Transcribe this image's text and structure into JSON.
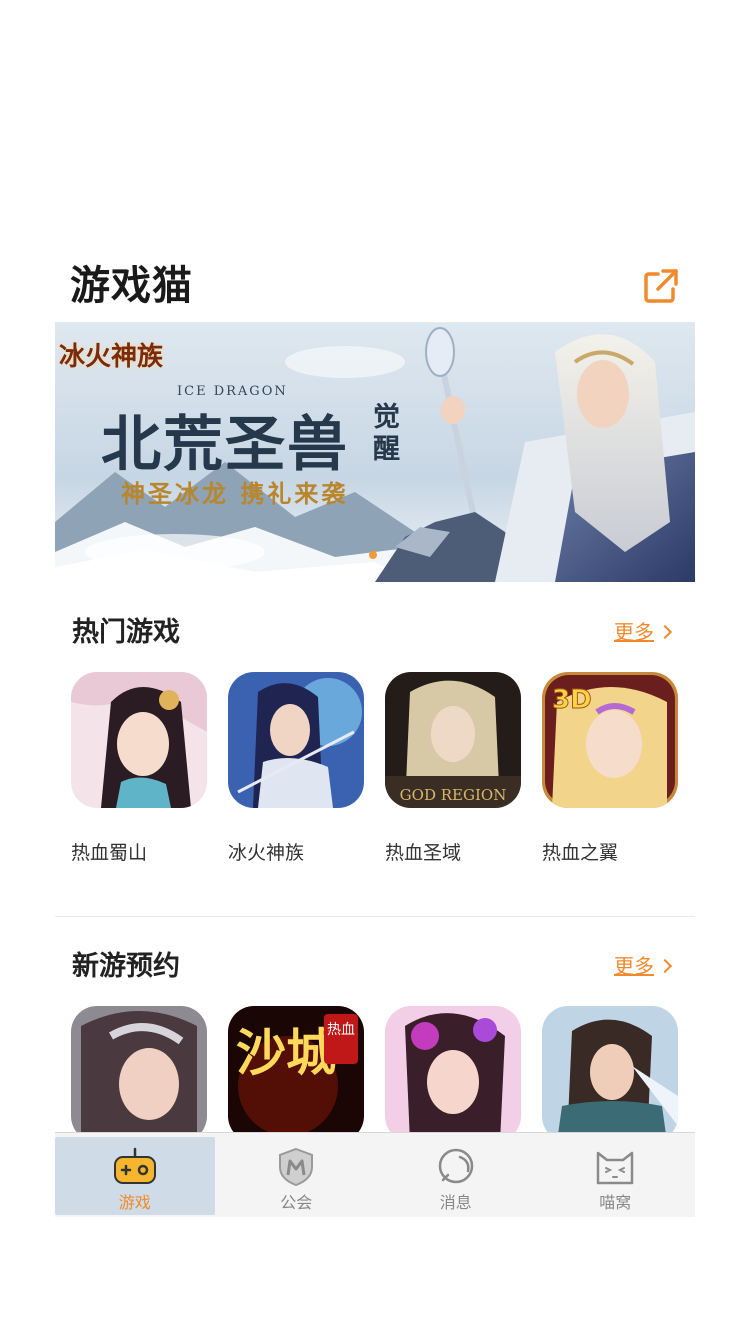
{
  "header": {
    "logo": "游戏猫",
    "share_icon": "share-external-icon"
  },
  "banner": {
    "brand": "冰火神族",
    "subtitle_en": "ICE DRAGON",
    "headline": "北荒圣兽",
    "side_text": "觉醒",
    "tagline": "神圣冰龙 携礼来袭"
  },
  "hot_games": {
    "title": "热门游戏",
    "more_label": "更多",
    "items": [
      {
        "name": "热血蜀山",
        "icon": "game-icon-rexue-shushan"
      },
      {
        "name": "冰火神族",
        "icon": "game-icon-binghuo-shenzu"
      },
      {
        "name": "热血圣域",
        "icon": "game-icon-rexue-shengyu",
        "icon_text": "GOD REGION"
      },
      {
        "name": "热血之翼",
        "icon": "game-icon-rexue-zhiyi",
        "icon_text": "3D"
      }
    ]
  },
  "new_games": {
    "title": "新游预约",
    "more_label": "更多",
    "items": [
      {
        "icon": "game-icon-new-1"
      },
      {
        "icon": "game-icon-new-2",
        "icon_text": "沙城",
        "badge": "热血"
      },
      {
        "icon": "game-icon-new-3"
      },
      {
        "icon": "game-icon-new-4"
      }
    ]
  },
  "tabbar": {
    "tabs": [
      {
        "label": "游戏",
        "icon": "gamepad-icon",
        "active": true
      },
      {
        "label": "公会",
        "icon": "shield-icon",
        "active": false
      },
      {
        "label": "消息",
        "icon": "chat-bubble-icon",
        "active": false
      },
      {
        "label": "喵窝",
        "icon": "cat-face-icon",
        "active": false
      }
    ]
  },
  "colors": {
    "accent": "#f08a2c",
    "tab_active_bg": "#cfdbe7",
    "tabbar_bg": "#f4f4f4"
  }
}
